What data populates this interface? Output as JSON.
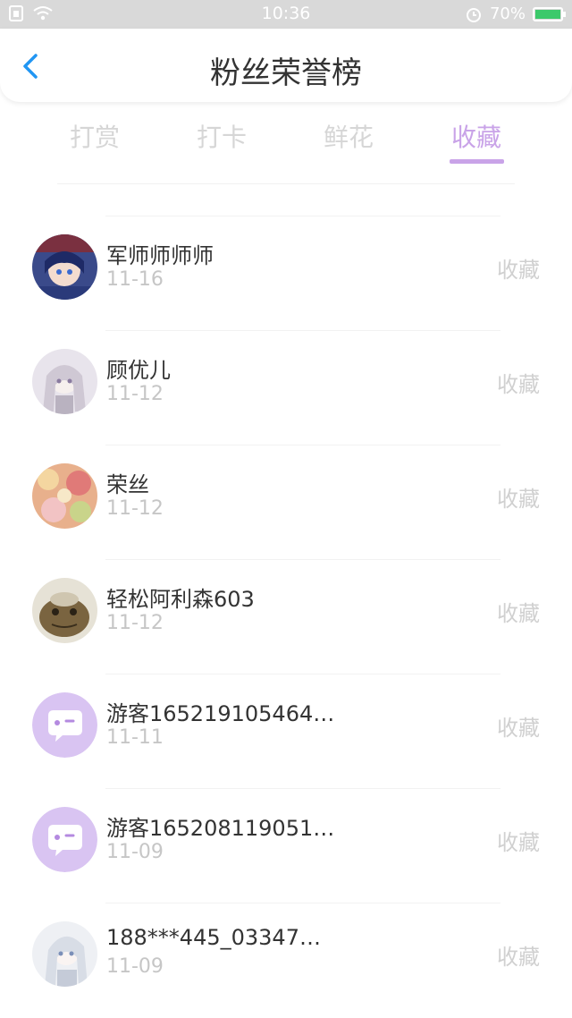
{
  "status_bar": {
    "time": "10:36",
    "battery": "70%"
  },
  "header": {
    "title": "粉丝荣誉榜"
  },
  "tabs": [
    {
      "label": "打赏",
      "active": false
    },
    {
      "label": "打卡",
      "active": false
    },
    {
      "label": "鲜花",
      "active": false
    },
    {
      "label": "收藏",
      "active": true
    }
  ],
  "colors": {
    "accent": "#c9a3e8",
    "muted": "#d6d6d6",
    "text": "#333333"
  },
  "fans": [
    {
      "name": "军师师师师",
      "date": "11-16",
      "action": "收藏",
      "avatar": "anime-portrait-dark"
    },
    {
      "name": "顾优儿",
      "date": "11-12",
      "action": "收藏",
      "avatar": "anime-portrait-white"
    },
    {
      "name": "荣丝",
      "date": "11-12",
      "action": "收藏",
      "avatar": "floral-pattern"
    },
    {
      "name": "轻松阿利森603",
      "date": "11-12",
      "action": "收藏",
      "avatar": "toad-photo"
    },
    {
      "name": "游客165219105464…",
      "date": "11-11",
      "action": "收藏",
      "avatar": "default-chat-avatar"
    },
    {
      "name": "游客165208119051…",
      "date": "11-09",
      "action": "收藏",
      "avatar": "default-chat-avatar"
    },
    {
      "name": "188***445_03347…",
      "date": "11-09",
      "action": "收藏",
      "avatar": "anime-portrait-silver"
    }
  ]
}
